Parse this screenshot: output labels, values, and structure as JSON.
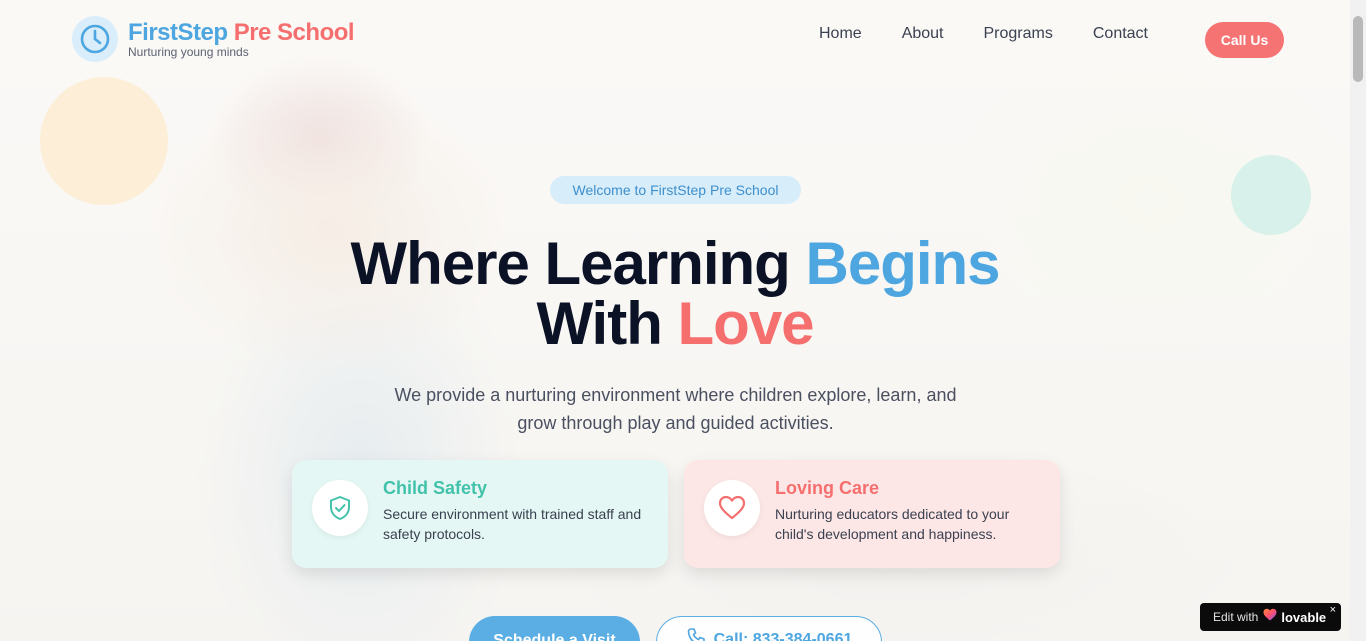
{
  "brand": {
    "name_part1": "FirstStep",
    "name_part2": "Pre School",
    "tagline": "Nurturing young minds",
    "logo_icon": "clock-icon",
    "colors": {
      "blue": "#4da6e0",
      "coral": "#f56f6f",
      "teal": "#42c2ab"
    }
  },
  "nav": {
    "items": [
      {
        "label": "Home"
      },
      {
        "label": "About"
      },
      {
        "label": "Programs"
      },
      {
        "label": "Contact"
      }
    ],
    "cta_label": "Call Us"
  },
  "hero": {
    "badge": "Welcome to FirstStep Pre School",
    "headline_part1": "Where Learning ",
    "headline_highlight1": "Begins",
    "headline_part2": "With ",
    "headline_highlight2": "Love",
    "lead": "We provide a nurturing environment where children explore, learn, and grow through play and guided activities."
  },
  "features": [
    {
      "icon": "shield-check-icon",
      "title": "Child Safety",
      "description": "Secure environment with trained staff and safety protocols."
    },
    {
      "icon": "heart-icon",
      "title": "Loving Care",
      "description": "Nurturing educators dedicated to your child's development and happiness."
    }
  ],
  "actions": {
    "schedule_label": "Schedule a Visit",
    "call_label": "Call: 833-384-0661",
    "call_icon": "phone-icon"
  },
  "badge_widget": {
    "edit_label": "Edit with",
    "brand": "lovable",
    "close": "×"
  }
}
